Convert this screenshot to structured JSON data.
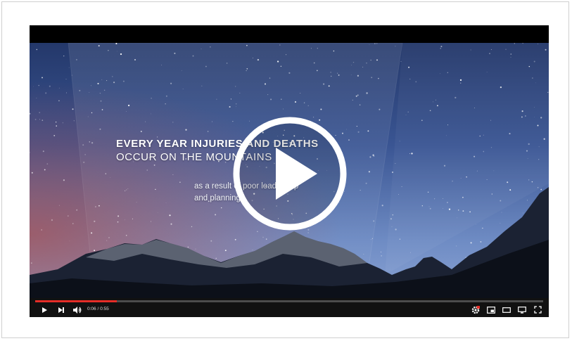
{
  "video": {
    "title_line_1": "EVERY YEAR INJURIES AND DEATHS",
    "title_line_2": "OCCUR ON THE MOUNTAINS",
    "subtitle_line_1": "as a result of poor leadership",
    "subtitle_line_2": "and planning."
  },
  "controls": {
    "current_time": "0:06",
    "duration": "0:55",
    "time_separator": " / ",
    "progress_percent": 16,
    "accent_color": "#e52d27",
    "icons": [
      "play-icon",
      "next-icon",
      "volume-icon",
      "settings-icon",
      "miniplayer-icon",
      "theater-icon",
      "cast-icon",
      "fullscreen-icon"
    ]
  }
}
